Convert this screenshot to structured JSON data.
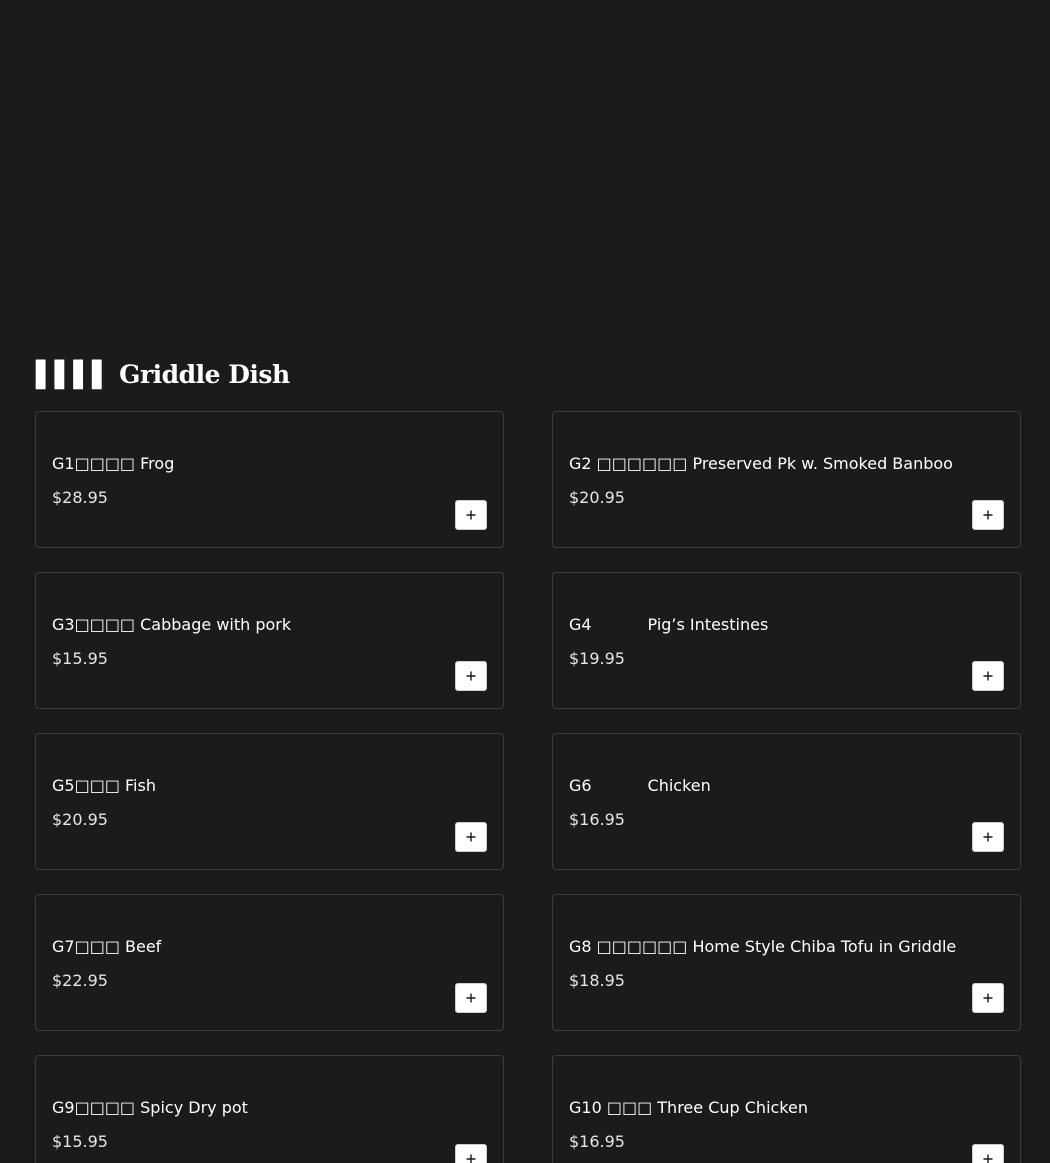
{
  "section": {
    "title": "▌▌▌▌ Griddle Dish"
  },
  "items": [
    {
      "name": "G1□□□□ Frog",
      "price": "$28.95"
    },
    {
      "name": "G2 □□□□□□ Preserved Pk w. Smoked Banboo",
      "price": "$20.95"
    },
    {
      "name": "G3□□□□ Cabbage with pork",
      "price": "$15.95"
    },
    {
      "name": "G4           Pig’s Intestines",
      "price": "$19.95"
    },
    {
      "name": "G5□□□ Fish",
      "price": "$20.95"
    },
    {
      "name": "G6           Chicken",
      "price": "$16.95"
    },
    {
      "name": "G7□□□ Beef",
      "price": "$22.95"
    },
    {
      "name": "G8 □□□□□□ Home Style Chiba Tofu in Griddle",
      "price": "$18.95"
    },
    {
      "name": "G9□□□□ Spicy Dry pot",
      "price": "$15.95"
    },
    {
      "name": "G10 □□□ Three Cup Chicken",
      "price": "$16.95"
    }
  ],
  "add_button": {
    "icon": "plus-icon"
  }
}
